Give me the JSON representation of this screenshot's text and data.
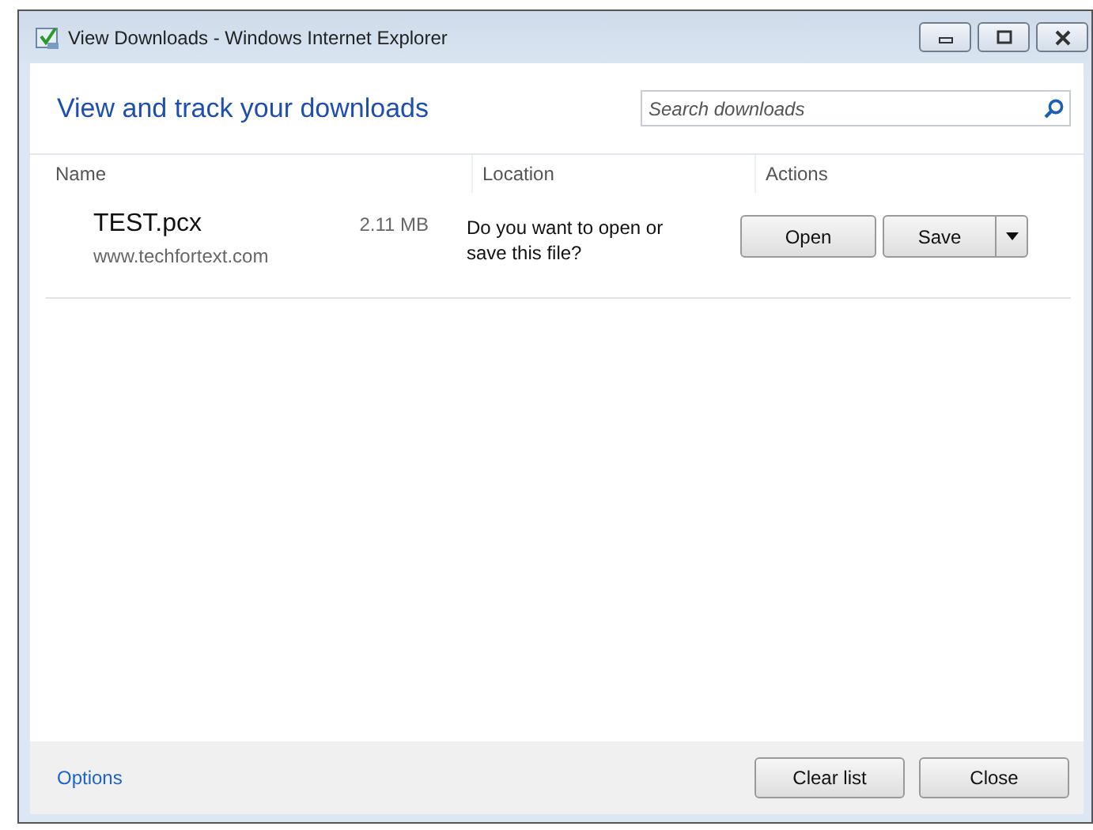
{
  "window": {
    "title": "View Downloads - Windows Internet Explorer"
  },
  "heading": "View and track your downloads",
  "search": {
    "placeholder": "Search downloads"
  },
  "columns": [
    "Name",
    "Location",
    "Actions"
  ],
  "downloads": [
    {
      "name": "TEST.pcx",
      "size": "2.11 MB",
      "source": "www.techfortext.com",
      "location": "Do you want to open or save this file?",
      "actions": [
        {
          "label": "Open",
          "kind": "plain"
        },
        {
          "label": "Save",
          "kind": "split"
        }
      ]
    }
  ],
  "footer": {
    "link": "Options",
    "buttons": [
      "Clear list",
      "Close"
    ]
  }
}
